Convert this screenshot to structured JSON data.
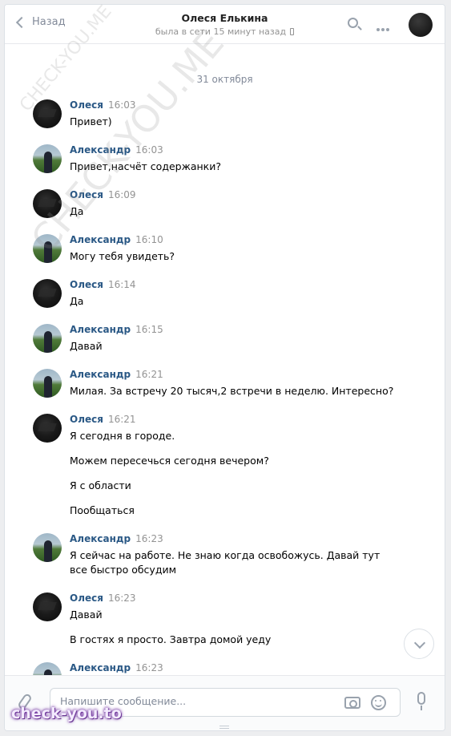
{
  "header": {
    "back_label": "Назад",
    "contact_name": "Олеся Елькина",
    "status": "была в сети 15 минут назад"
  },
  "chat": {
    "date_separator": "31 октября",
    "messages": [
      {
        "author": "Олеся",
        "time": "16:03",
        "lines": [
          "Привет)"
        ]
      },
      {
        "author": "Александр",
        "time": "16:03",
        "lines": [
          "Привет,насчёт содержанки?"
        ]
      },
      {
        "author": "Олеся",
        "time": "16:09",
        "lines": [
          "Да"
        ]
      },
      {
        "author": "Александр",
        "time": "16:10",
        "lines": [
          "Могу тебя увидеть?"
        ]
      },
      {
        "author": "Олеся",
        "time": "16:14",
        "lines": [
          "Да"
        ]
      },
      {
        "author": "Александр",
        "time": "16:15",
        "lines": [
          "Давай"
        ]
      },
      {
        "author": "Александр",
        "time": "16:21",
        "lines": [
          "Милая. За встречу 20 тысяч,2 встречи в неделю. Интересно?"
        ]
      },
      {
        "author": "Олеся",
        "time": "16:21",
        "lines": [
          "Я сегодня в городе.",
          "Можем пересечься сегодня вечером?",
          "Я с области",
          "Пообщаться"
        ]
      },
      {
        "author": "Александр",
        "time": "16:23",
        "lines": [
          "Я сейчас на работе. Не знаю когда освобожусь. Давай тут все быстро обсудим"
        ]
      },
      {
        "author": "Олеся",
        "time": "16:23",
        "lines": [
          "Давай",
          "В гостях я просто. Завтра домой уеду"
        ]
      },
      {
        "author": "Александр",
        "time": "16:23",
        "lines": []
      }
    ]
  },
  "composer": {
    "placeholder": "Напишите сообщение..."
  },
  "watermarks": {
    "small": "CHECK-YOU.ME",
    "large": "CHECK-YOU.ME",
    "badge": "check-you.to"
  },
  "colors": {
    "link": "#2a5885",
    "muted": "#939393",
    "icon": "#99a2ad",
    "background": "#edeef0"
  }
}
